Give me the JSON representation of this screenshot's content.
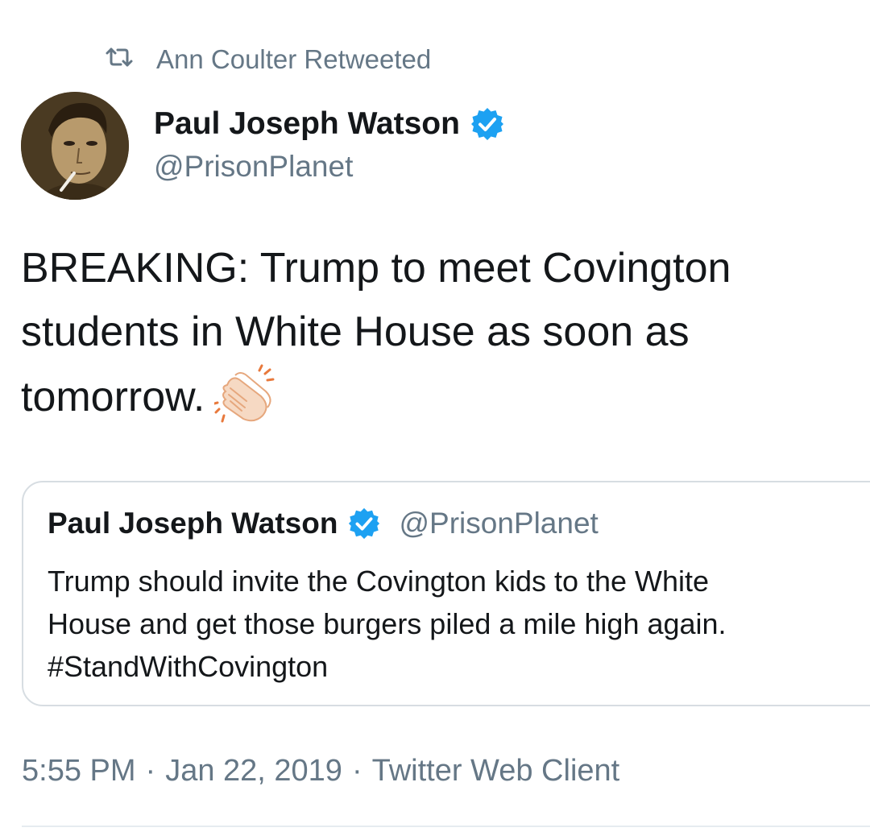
{
  "retweet": {
    "label": "Ann Coulter Retweeted",
    "icon": "retweet-icon"
  },
  "author": {
    "name": "Paul Joseph Watson",
    "handle": "@PrisonPlanet",
    "verified": true,
    "verified_color": "#1da1f2",
    "avatar": "profile-photo"
  },
  "tweet": {
    "text": "BREAKING: Trump to meet Covington students in White House as soon as tomorrow.",
    "emoji": "clapping-hands-icon"
  },
  "quoted_tweet": {
    "name": "Paul Joseph Watson",
    "handle": "@PrisonPlanet",
    "verified": true,
    "text_lines": [
      "Trump should invite the Covington kids to the White",
      "House and get those burgers piled a mile high again.",
      "#StandWithCovington"
    ]
  },
  "footer": {
    "time": "5:55 PM",
    "date": "Jan 22, 2019",
    "client": "Twitter Web Client",
    "separator": "·"
  },
  "colors": {
    "text": "#14171a",
    "secondary": "#657786",
    "border": "#d7dde2",
    "verified_blue": "#1da1f2"
  }
}
